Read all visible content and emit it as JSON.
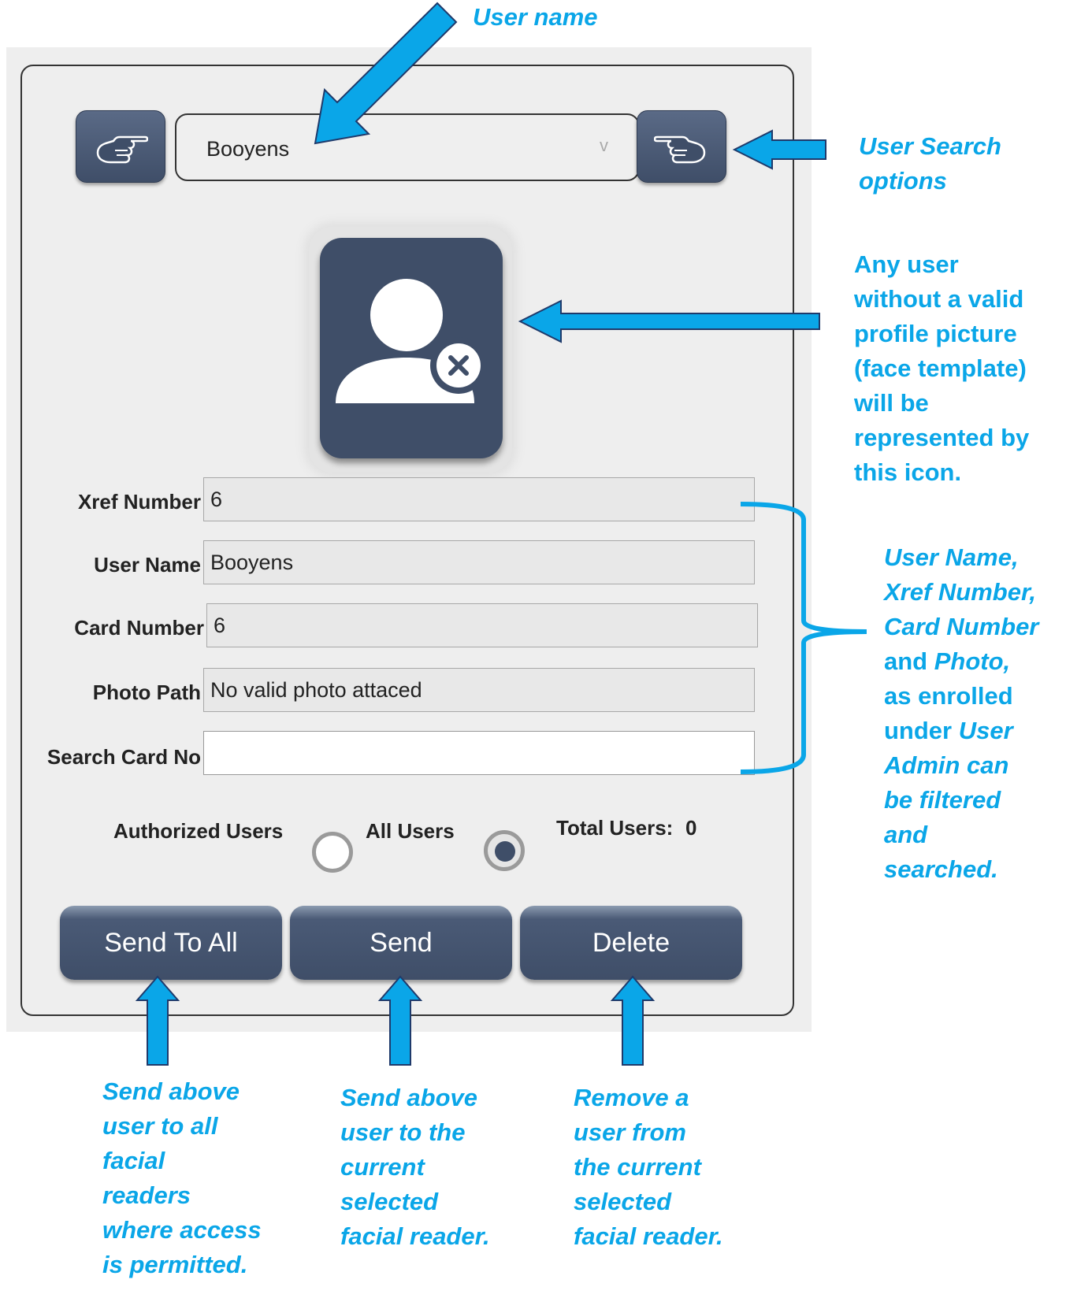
{
  "selector": {
    "value": "Booyens",
    "chevron": "v"
  },
  "nav": {
    "prev_icon": "pointing-hand-left-icon",
    "next_icon": "pointing-hand-right-icon"
  },
  "avatar": {
    "icon": "user-no-photo-icon"
  },
  "fields": {
    "xref": {
      "label": "Xref Number",
      "value": "6"
    },
    "username": {
      "label": "User Name",
      "value": "Booyens"
    },
    "card": {
      "label": "Card Number",
      "value": "6"
    },
    "photo": {
      "label": "Photo Path",
      "value": "No valid photo attaced"
    },
    "search": {
      "label": "Search Card No",
      "value": ""
    }
  },
  "filters": {
    "authorized": "Authorized Users",
    "all": "All Users",
    "selected": "all",
    "total_label": "Total Users:",
    "total_value": "0"
  },
  "buttons": {
    "send_all": "Send To All",
    "send": "Send",
    "delete": "Delete"
  },
  "annotations": {
    "user_name": "User name",
    "search_1": "User Search",
    "search_2": "options",
    "icon_lines": [
      "Any user",
      "without a valid",
      "profile picture",
      "(face template)",
      "will be",
      "represented by",
      "this icon."
    ],
    "filter_1": "User Name,",
    "filter_2": "Xref Number,",
    "filter_3": "Card Number",
    "filter_4a": "and ",
    "filter_4b": "Photo,",
    "filter_5": "as enrolled",
    "filter_6a": "under ",
    "filter_6b": "User",
    "filter_7": "Admin can",
    "filter_8": "be filtered",
    "filter_9": "and",
    "filter_10": "searched.",
    "send_all_lines": [
      "Send above",
      "user to all",
      "facial",
      "readers",
      "where access",
      "is permitted."
    ],
    "send_lines": [
      "Send above",
      "user to the",
      "current",
      "selected",
      "facial reader."
    ],
    "delete_lines": [
      "Remove a",
      "user from",
      "the current",
      "selected",
      "facial reader."
    ]
  },
  "colors": {
    "annotation": "#0aa6e8",
    "button": "#3f4e68",
    "panel": "#eeeeee"
  }
}
